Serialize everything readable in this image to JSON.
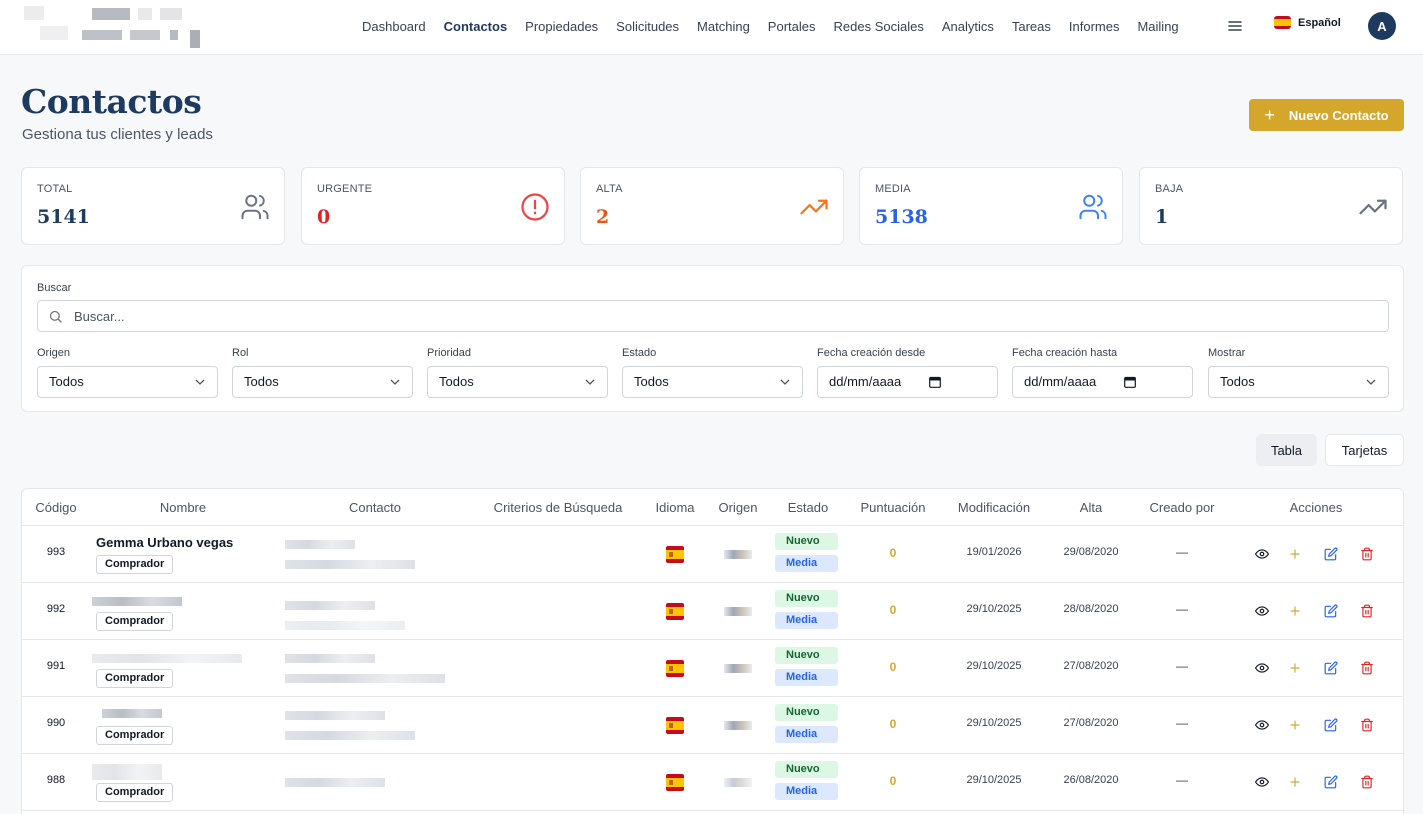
{
  "nav": {
    "items": [
      "Dashboard",
      "Contactos",
      "Propiedades",
      "Solicitudes",
      "Matching",
      "Portales",
      "Redes Sociales",
      "Analytics",
      "Tareas",
      "Informes",
      "Mailing"
    ],
    "active": "Contactos",
    "language": "Español",
    "avatar_initial": "A"
  },
  "header": {
    "title": "Contactos",
    "subtitle": "Gestiona tus clientes y leads",
    "new_button": "Nuevo Contacto"
  },
  "stats": [
    {
      "label": "TOTAL",
      "value": "5141",
      "color": "#1e3a5f",
      "icon": "users-icon",
      "icon_color": "#6b7280"
    },
    {
      "label": "URGENTE",
      "value": "0",
      "color": "#dc2626",
      "icon": "alert-circle-icon",
      "icon_color": "#ef4444"
    },
    {
      "label": "ALTA",
      "value": "2",
      "color": "#ea580c",
      "icon": "trending-up-icon",
      "icon_color": "#f97316"
    },
    {
      "label": "MEDIA",
      "value": "5138",
      "color": "#2563eb",
      "icon": "users-icon",
      "icon_color": "#3b82f6"
    },
    {
      "label": "BAJA",
      "value": "1",
      "color": "#1e3a5f",
      "icon": "trending-up-icon",
      "icon_color": "#6b7280"
    }
  ],
  "filters": {
    "search_label": "Buscar",
    "search_placeholder": "Buscar...",
    "fields": [
      {
        "label": "Origen",
        "value": "Todos"
      },
      {
        "label": "Rol",
        "value": "Todos"
      },
      {
        "label": "Prioridad",
        "value": "Todos"
      },
      {
        "label": "Estado",
        "value": "Todos"
      },
      {
        "label": "Fecha creación desde",
        "value": "dd/mm/aaaa"
      },
      {
        "label": "Fecha creación hasta",
        "value": "dd/mm/aaaa"
      },
      {
        "label": "Mostrar",
        "value": "Todos"
      }
    ]
  },
  "view_toggle": {
    "tabla": "Tabla",
    "tarjetas": "Tarjetas",
    "active": "Tabla"
  },
  "table": {
    "columns": [
      "Código",
      "Nombre",
      "Contacto",
      "Criterios de Búsqueda",
      "Idioma",
      "Origen",
      "Estado",
      "Puntuación",
      "Modificación",
      "Alta",
      "Creado por",
      "Acciones"
    ],
    "rows": [
      {
        "code": "993",
        "name": "Gemma Urbano vegas",
        "role": "Comprador",
        "estado": "Nuevo",
        "prioridad": "Media",
        "score": "0",
        "modified": "19/01/2026",
        "created": "29/08/2020",
        "creator": "—"
      },
      {
        "code": "992",
        "name": "",
        "role": "Comprador",
        "estado": "Nuevo",
        "prioridad": "Media",
        "score": "0",
        "modified": "29/10/2025",
        "created": "28/08/2020",
        "creator": "—"
      },
      {
        "code": "991",
        "name": "",
        "role": "Comprador",
        "estado": "Nuevo",
        "prioridad": "Media",
        "score": "0",
        "modified": "29/10/2025",
        "created": "27/08/2020",
        "creator": "—"
      },
      {
        "code": "990",
        "name": "",
        "role": "Comprador",
        "estado": "Nuevo",
        "prioridad": "Media",
        "score": "0",
        "modified": "29/10/2025",
        "created": "27/08/2020",
        "creator": "—"
      },
      {
        "code": "988",
        "name": "",
        "role": "Comprador",
        "estado": "Nuevo",
        "prioridad": "Media",
        "score": "0",
        "modified": "29/10/2025",
        "created": "26/08/2020",
        "creator": "—"
      }
    ]
  },
  "colors": {
    "accent": "#d4a72c",
    "brand": "#1e3a5f"
  }
}
